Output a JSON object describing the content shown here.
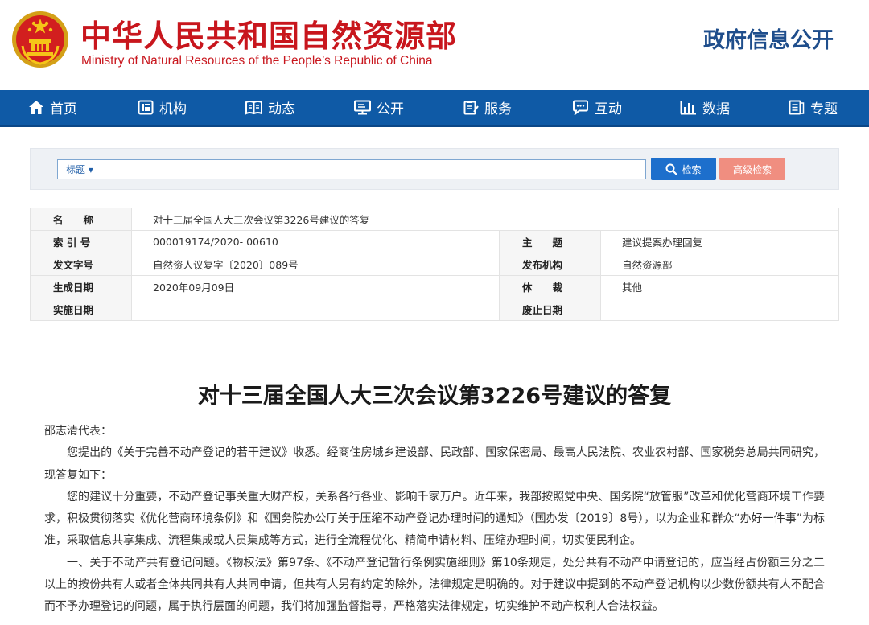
{
  "header": {
    "site_title_cn": "中华人民共和国自然资源部",
    "site_title_en": "Ministry of Natural Resources of the People’s Republic of China",
    "section_title": "政府信息公开"
  },
  "nav": {
    "items": [
      {
        "label": "首页",
        "icon": "home-icon"
      },
      {
        "label": "机构",
        "icon": "org-icon"
      },
      {
        "label": "动态",
        "icon": "book-icon"
      },
      {
        "label": "公开",
        "icon": "monitor-icon"
      },
      {
        "label": "服务",
        "icon": "clipboard-icon"
      },
      {
        "label": "互动",
        "icon": "chat-icon"
      },
      {
        "label": "数据",
        "icon": "bar-chart-icon"
      },
      {
        "label": "专题",
        "icon": "topic-icon"
      }
    ]
  },
  "search": {
    "field_select": "标题 ▾",
    "search_label": "检索",
    "advanced_label": "高级检索"
  },
  "meta": {
    "name_label": "名　　称",
    "name_value": "对十三届全国人大三次会议第3226号建议的答复",
    "index_label": "索 引 号",
    "index_value": "000019174/2020- 00610",
    "subject_label": "主　　题",
    "subject_value": "建议提案办理回复",
    "docno_label": "发文字号",
    "docno_value": "自然资人议复字〔2020〕089号",
    "issuer_label": "发布机构",
    "issuer_value": "自然资源部",
    "date_label": "生成日期",
    "date_value": "2020年09月09日",
    "genre_label": "体　　裁",
    "genre_value": "其他",
    "impl_label": "实施日期",
    "impl_value": "",
    "expire_label": "废止日期",
    "expire_value": ""
  },
  "article": {
    "title": "对十三届全国人大三次会议第3226号建议的答复",
    "salutation": "邵志清代表：",
    "p1": "您提出的《关于完善不动产登记的若干建议》收悉。经商住房城乡建设部、民政部、国家保密局、最高人民法院、农业农村部、国家税务总局共同研究，现答复如下：",
    "p2": "您的建议十分重要，不动产登记事关重大财产权，关系各行各业、影响千家万户。近年来，我部按照党中央、国务院“放管服”改革和优化营商环境工作要求，积极贯彻落实《优化营商环境条例》和《国务院办公厅关于压缩不动产登记办理时间的通知》（国办发〔2019〕8号），以为企业和群众“办好一件事”为标准，采取信息共享集成、流程集成或人员集成等方式，进行全流程优化、精简申请材料、压缩办理时间，切实便民利企。",
    "p3": "一、关于不动产共有登记问题。《物权法》第97条、《不动产登记暂行条例实施细则》第10条规定，处分共有不动产申请登记的，应当经占份额三分之二以上的按份共有人或者全体共同共有人共同申请，但共有人另有约定的除外，法律规定是明确的。对于建议中提到的不动产登记机构以少数份额共有人不配合而不予办理登记的问题，属于执行层面的问题，我们将加强监督指导，严格落实法律规定，切实维护不动产权利人合法权益。"
  },
  "colors": {
    "brand_red": "#c8161d",
    "nav_blue": "#0f5aa6",
    "search_blue": "#1d6fcc",
    "advanced_salmon": "#f08e80"
  }
}
